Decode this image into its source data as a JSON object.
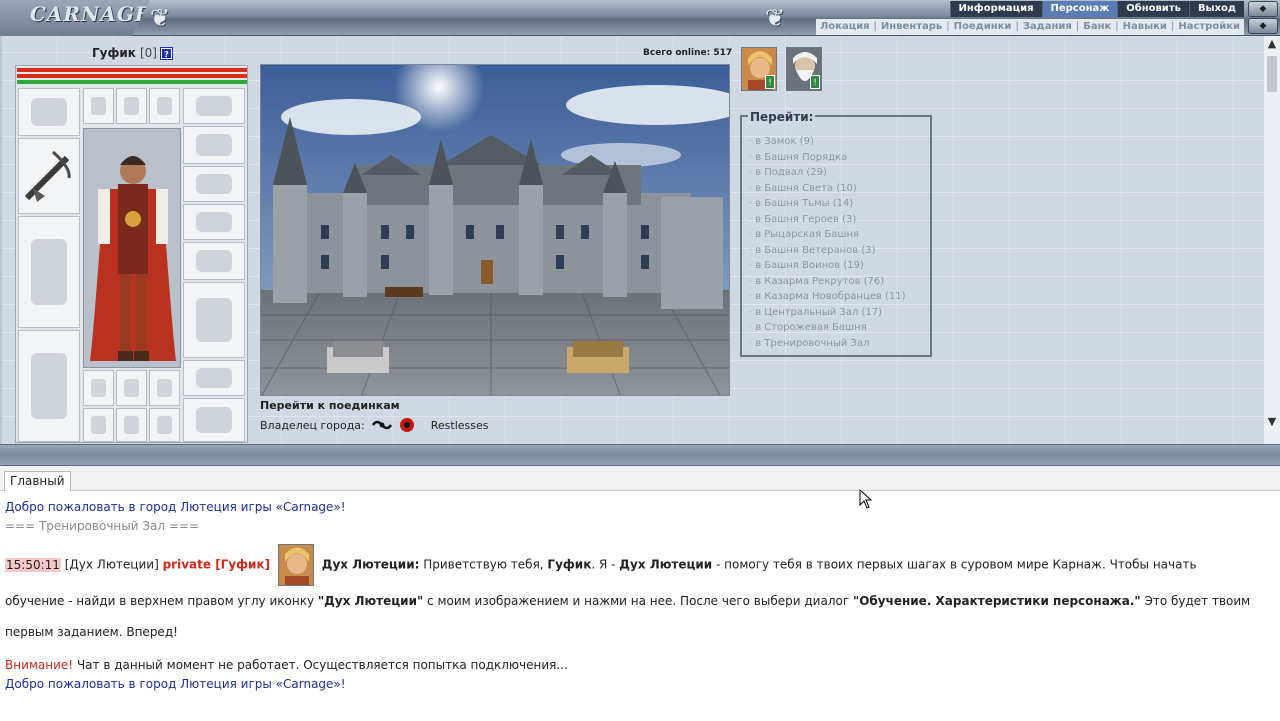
{
  "header": {
    "logo_text": "CARNAGE",
    "main_tabs": [
      {
        "label": "Информация",
        "active": false
      },
      {
        "label": "Персонаж",
        "active": true
      },
      {
        "label": "Обновить",
        "active": false
      },
      {
        "label": "Выход",
        "active": false
      }
    ],
    "sub_tabs": [
      "Локация",
      "Инвентарь",
      "Поединки",
      "Задания",
      "Банк",
      "Навыки",
      "Настройки"
    ],
    "sub_separator": "|"
  },
  "character": {
    "name": "Гуфик",
    "level": "[0]",
    "info_icon": "?"
  },
  "online": {
    "label": "Всего online: 517"
  },
  "scene": {
    "duel_link": "Перейти к поединкам",
    "owner_label": "Владелец города:",
    "owner_name": "Restlesses"
  },
  "goto": {
    "title": "Перейти:",
    "items": [
      "в Замок (9)",
      "в Башня Порядка",
      "в Подвал (29)",
      "в Башня Света (10)",
      "в Башня Тьмы (14)",
      "в Башня Героев (3)",
      "в Рыцарская Башня",
      "в Башня Ветеранов (3)",
      "в Башня Воинов (19)",
      "в Казарма Рекрутов (76)",
      "в Казарма Новобранцев (11)",
      "в Центральный Зал (17)",
      "в Сторожевая Башня",
      "в Тренировочный Зал"
    ]
  },
  "portraits": [
    {
      "name": "guide-portrait",
      "badge": "!"
    },
    {
      "name": "elder-portrait",
      "badge": "!"
    }
  ],
  "chat": {
    "tab": "Главный",
    "welcome1": "Добро пожаловать в город Лютеция игры «Carnage»!",
    "room": "=== Тренировочный Зал ===",
    "message": {
      "time": "15:50:11",
      "from": "[Дух Лютеции]",
      "private": "private [Гуфик]",
      "speaker": "Дух Лютеции:",
      "t1": " Приветствую тебя, ",
      "t1b": "Гуфик",
      "t2": ". Я - ",
      "t2b": "Дух Лютеции",
      "t3": " - помогу тебя в твоих первых шагах в суровом мире Карнаж. Чтобы начать обучение - найди в верхнем правом углу иконку ",
      "t3b": "\"Дух Лютеции\"",
      "t4": " с моим изображением и нажми на нее. После чего выбери диалог ",
      "t4b": "\"Обучение. Характеристики персонажа.\"",
      "t5": " Это будет твоим первым заданием. Вперед!"
    },
    "warn_label": "Внимание!",
    "warn_text": " Чат в данный момент не работает. Осуществляется попытка подключения...",
    "welcome2": "Добро пожаловать в город Лютеция игры «Carnage»!"
  },
  "colors": {
    "hp": "#d62c1b",
    "mana": "#2fa83a",
    "active_tab": "#5b7cb4",
    "private": "#d4281c",
    "welcome": "#1d2f9e"
  }
}
